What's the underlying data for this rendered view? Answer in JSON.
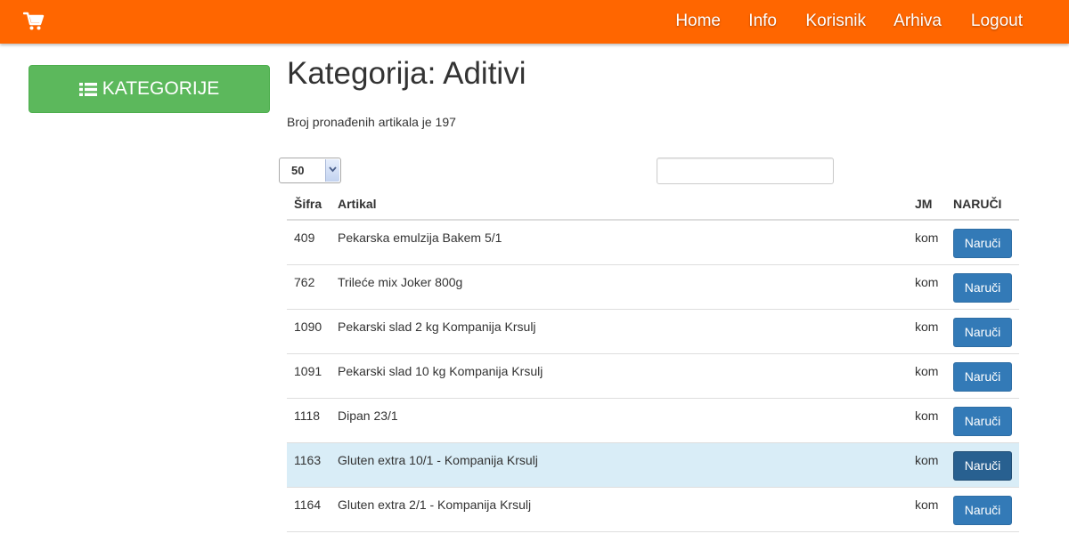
{
  "navbar": {
    "cart_icon": "shopping-cart-icon",
    "bg_color": "#ff6600",
    "links": [
      {
        "id": "home",
        "label": "Home"
      },
      {
        "id": "info",
        "label": "Info"
      },
      {
        "id": "korisnik",
        "label": "Korisnik"
      },
      {
        "id": "arhiva",
        "label": "Arhiva"
      },
      {
        "id": "logout",
        "label": "Logout"
      }
    ]
  },
  "sidebar": {
    "categories_label": "KATEGORIJE",
    "categories_icon": "list-icon",
    "button_color": "#5cb85c"
  },
  "main": {
    "title": "Kategorija: Aditivi",
    "count_text": "Broj pronađenih artikala je 197",
    "per_page": {
      "selected": "50"
    },
    "search": {
      "value": "",
      "placeholder": ""
    }
  },
  "table": {
    "headers": {
      "sifra": "Šifra",
      "artikal": "Artikal",
      "jm": "JM",
      "naruci": "NARUČI"
    },
    "order_label": "Naruči",
    "order_button_color": "#337ab7",
    "highlight_color": "#d9edf7",
    "rows": [
      {
        "sifra": "409",
        "artikal": "Pekarska emulzija Bakem 5/1",
        "jm": "kom",
        "highlighted": false
      },
      {
        "sifra": "762",
        "artikal": "Trileće mix Joker 800g",
        "jm": "kom",
        "highlighted": false
      },
      {
        "sifra": "1090",
        "artikal": "Pekarski slad 2 kg Kompanija Krsulj",
        "jm": "kom",
        "highlighted": false
      },
      {
        "sifra": "1091",
        "artikal": "Pekarski slad 10 kg Kompanija Krsulj",
        "jm": "kom",
        "highlighted": false
      },
      {
        "sifra": "1118",
        "artikal": "Dipan 23/1",
        "jm": "kom",
        "highlighted": false
      },
      {
        "sifra": "1163",
        "artikal": "Gluten extra 10/1 - Kompanija Krsulj",
        "jm": "kom",
        "highlighted": true
      },
      {
        "sifra": "1164",
        "artikal": "Gluten extra 2/1 - Kompanija Krsulj",
        "jm": "kom",
        "highlighted": false
      }
    ]
  }
}
